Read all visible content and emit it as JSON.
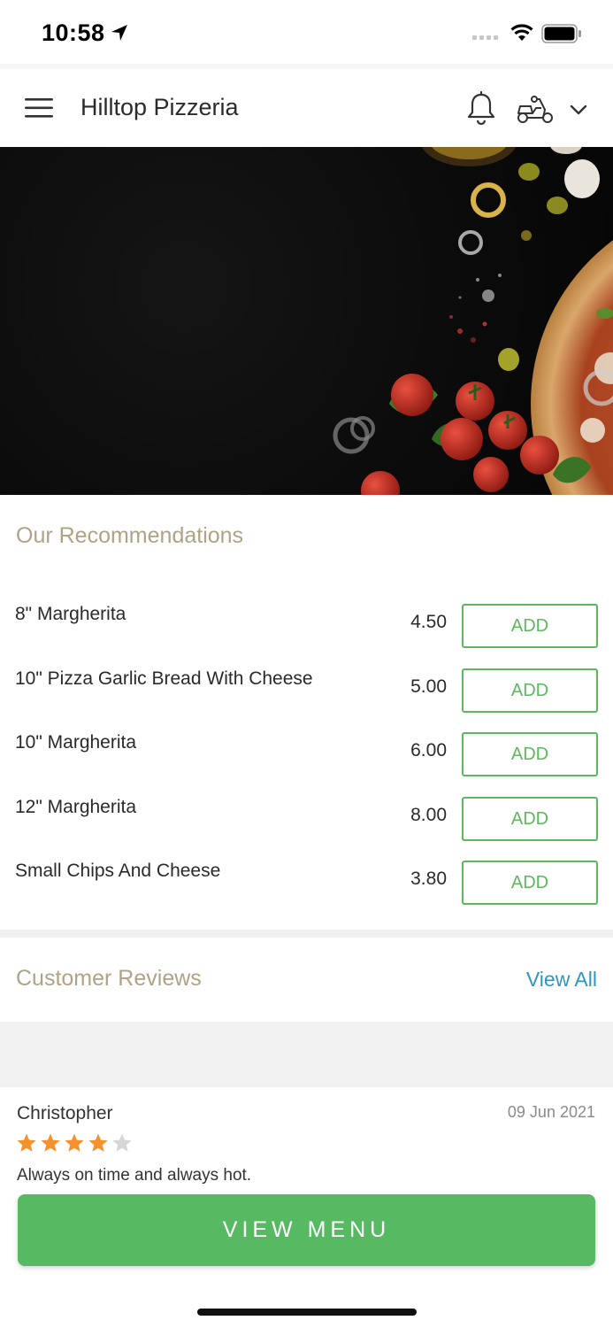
{
  "status_bar": {
    "time": "10:58"
  },
  "header": {
    "title": "Hilltop Pizzeria"
  },
  "recommendations": {
    "title": "Our Recommendations",
    "add_label": "ADD",
    "items": [
      {
        "name": "8\" Margherita",
        "price": "4.50"
      },
      {
        "name": "10\" Pizza Garlic Bread With Cheese",
        "price": "5.00"
      },
      {
        "name": "10\" Margherita",
        "price": "6.00"
      },
      {
        "name": "12\" Margherita",
        "price": "8.00"
      },
      {
        "name": "Small Chips And Cheese",
        "price": "3.80"
      }
    ]
  },
  "reviews": {
    "title": "Customer Reviews",
    "view_all": "View All",
    "items": [
      {
        "name": "Christopher",
        "date": "09 Jun 2021",
        "rating": 4,
        "max_rating": 5,
        "text": "Always on time and always hot."
      }
    ]
  },
  "cta": {
    "label": "VIEW MENU"
  },
  "colors": {
    "accent_green": "#5cb85c",
    "cta_green": "#57b962",
    "section_title": "#b0a286",
    "link_blue": "#2e96c2",
    "star_filled": "#f5922f",
    "star_empty": "#d6d6d6"
  },
  "icons": [
    "location-arrow-icon",
    "signal-icon",
    "wifi-icon",
    "battery-icon",
    "menu-icon",
    "bell-icon",
    "scooter-icon",
    "chevron-down-icon",
    "star-icon"
  ]
}
